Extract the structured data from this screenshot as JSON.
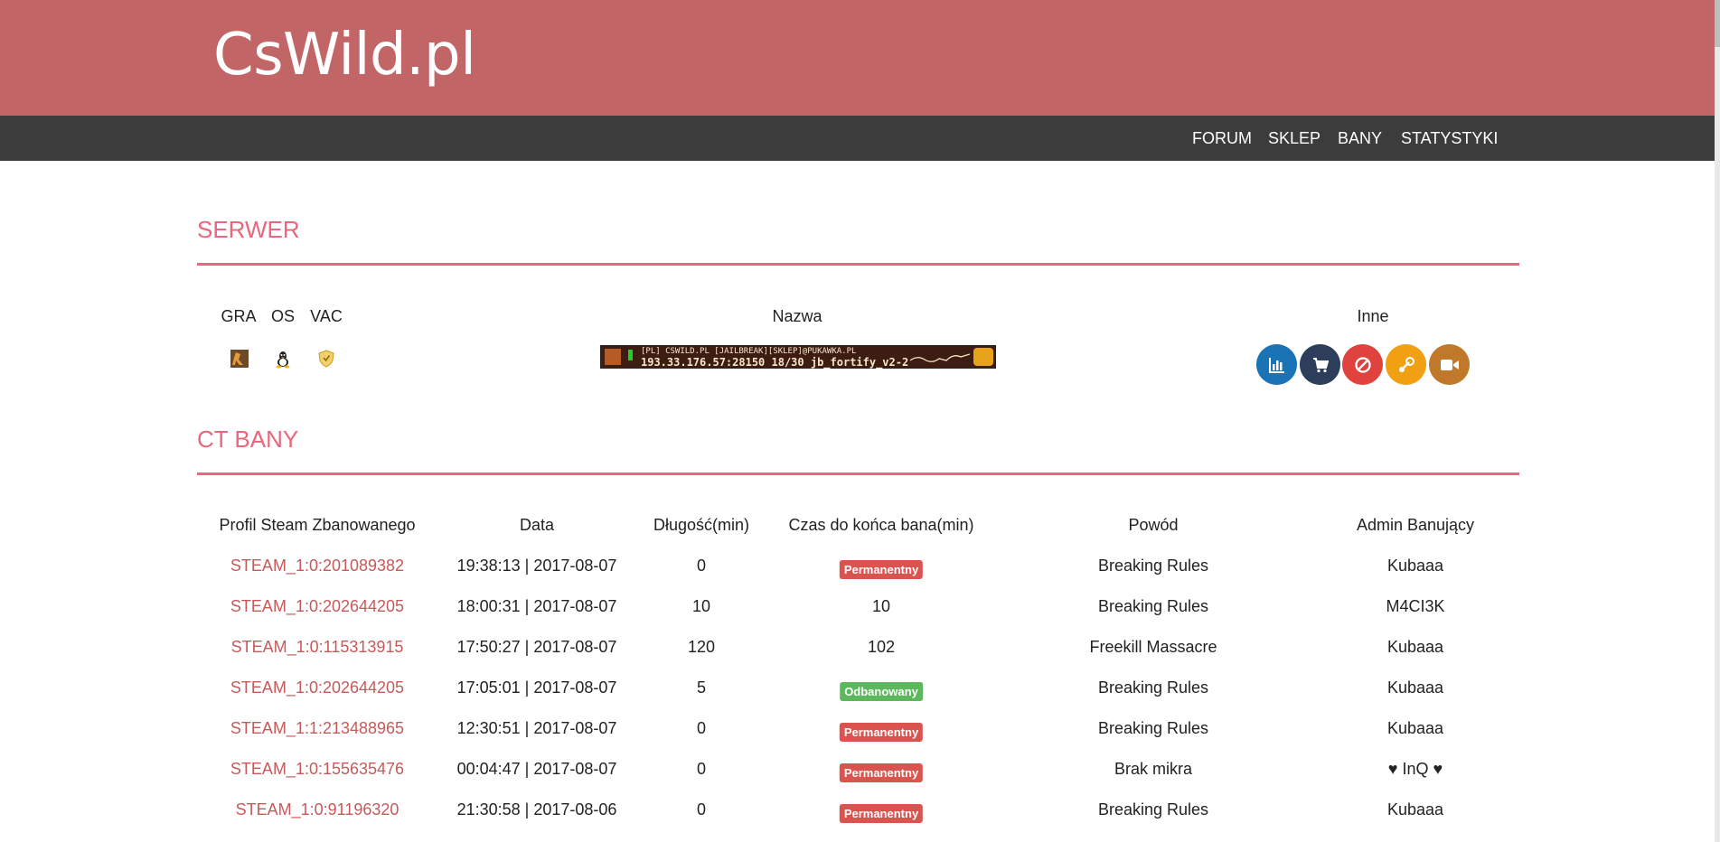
{
  "brand": "CsWild.pl",
  "nav": [
    "FORUM",
    "SKLEP",
    "BANY",
    "STATYSTYKI"
  ],
  "server": {
    "title": "SERWER",
    "cols": {
      "game": "GRA",
      "os": "OS",
      "vac": "VAC",
      "name": "Nazwa",
      "other": "Inne"
    },
    "banner": {
      "line1": "[PL] CSWILD.PL [JAILBREAK][SKLEP]@PUKAWKA.PL",
      "line2": "193.33.176.57:28150   18/30  jb_fortify_v2-2"
    },
    "icons": [
      "game-cs-icon",
      "linux-icon",
      "vac-shield-icon"
    ],
    "buttons": [
      {
        "name": "stats-button",
        "icon": "bar-chart-icon",
        "color": "#1a73b5"
      },
      {
        "name": "shop-button",
        "icon": "cart-icon",
        "color": "#2c3e5a"
      },
      {
        "name": "bans-button",
        "icon": "ban-icon",
        "color": "#e0433d"
      },
      {
        "name": "steam-button",
        "icon": "steam-icon",
        "color": "#f0a012"
      },
      {
        "name": "video-button",
        "icon": "video-icon",
        "color": "#c0782a"
      }
    ]
  },
  "bans": {
    "title": "CT BANY",
    "headers": [
      "Profil Steam Zbanowanego",
      "Data",
      "Długość(min)",
      "Czas do końca bana(min)",
      "Powód",
      "Admin Banujący"
    ],
    "rows": [
      {
        "steam": "STEAM_1:0:201089382",
        "date": "19:38:13 | 2017-08-07",
        "length": "0",
        "remaining": "Permanentny",
        "remaining_type": "red",
        "reason": "Breaking Rules",
        "admin": "Kubaaa"
      },
      {
        "steam": "STEAM_1:0:202644205",
        "date": "18:00:31 | 2017-08-07",
        "length": "10",
        "remaining": "10",
        "remaining_type": "text",
        "reason": "Breaking Rules",
        "admin": "M4CI3K"
      },
      {
        "steam": "STEAM_1:0:115313915",
        "date": "17:50:27 | 2017-08-07",
        "length": "120",
        "remaining": "102",
        "remaining_type": "text",
        "reason": "Freekill Massacre",
        "admin": "Kubaaa"
      },
      {
        "steam": "STEAM_1:0:202644205",
        "date": "17:05:01 | 2017-08-07",
        "length": "5",
        "remaining": "Odbanowany",
        "remaining_type": "green",
        "reason": "Breaking Rules",
        "admin": "Kubaaa"
      },
      {
        "steam": "STEAM_1:1:213488965",
        "date": "12:30:51 | 2017-08-07",
        "length": "0",
        "remaining": "Permanentny",
        "remaining_type": "red",
        "reason": "Breaking Rules",
        "admin": "Kubaaa"
      },
      {
        "steam": "STEAM_1:0:155635476",
        "date": "00:04:47 | 2017-08-07",
        "length": "0",
        "remaining": "Permanentny",
        "remaining_type": "red",
        "reason": "Brak mikra",
        "admin": "♥ InQ ♥"
      },
      {
        "steam": "STEAM_1:0:91196320",
        "date": "21:30:58 | 2017-08-06",
        "length": "0",
        "remaining": "Permanentny",
        "remaining_type": "red",
        "reason": "Breaking Rules",
        "admin": "Kubaaa"
      }
    ]
  }
}
